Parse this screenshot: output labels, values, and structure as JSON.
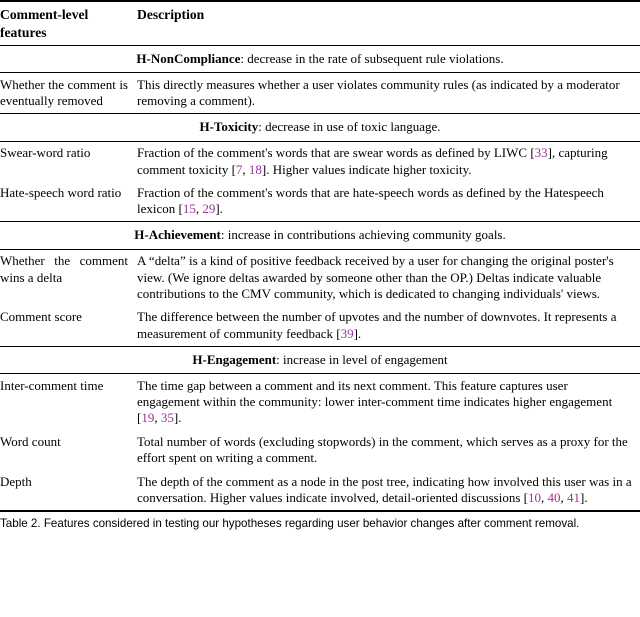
{
  "table": {
    "columns": {
      "feature_header": "Comment-level features",
      "description_header": "Description"
    },
    "sections": [
      {
        "hypothesis_name": "H-NonCompliance",
        "hypothesis_desc": ": decrease in the rate of subsequent rule violations.",
        "rows": [
          {
            "feature": "Whether the comment is eventually removed",
            "description": "This directly measures whether a user violates community rules (as indicated by a moderator removing a comment)."
          }
        ]
      },
      {
        "hypothesis_name": "H-Toxicity",
        "hypothesis_desc": ": decrease in use of toxic language.",
        "rows": [
          {
            "feature": "Swear-word ratio",
            "description_parts": [
              {
                "t": "Fraction of the comment's words that are swear words as defined by LIWC ["
              },
              {
                "t": "33",
                "cite": true
              },
              {
                "t": "], capturing comment toxicity ["
              },
              {
                "t": "7",
                "cite": true
              },
              {
                "t": ", "
              },
              {
                "t": "18",
                "cite": true
              },
              {
                "t": "]. Higher values indicate higher toxicity."
              }
            ]
          },
          {
            "feature": "Hate-speech word ratio",
            "description_parts": [
              {
                "t": "Fraction of the comment's words that are hate-speech words as defined by the Hatespeech lexicon ["
              },
              {
                "t": "15",
                "cite": true
              },
              {
                "t": ", "
              },
              {
                "t": "29",
                "cite": true
              },
              {
                "t": "]."
              }
            ]
          }
        ]
      },
      {
        "hypothesis_name": "H-Achievement",
        "hypothesis_desc": ": increase in contributions achieving community goals.",
        "rows": [
          {
            "feature": "Whether the comment wins a delta",
            "description": "A “delta” is a kind of positive feedback received by a user for changing the original poster's view. (We ignore deltas awarded by someone other than the OP.) Deltas indicate valuable contributions to the CMV community, which is dedicated to changing individuals' views."
          },
          {
            "feature": "Comment score",
            "description_parts": [
              {
                "t": "The difference between the number of upvotes and the number of downvotes. It represents a measurement of community feedback ["
              },
              {
                "t": "39",
                "cite": true
              },
              {
                "t": "]."
              }
            ]
          }
        ]
      },
      {
        "hypothesis_name": "H-Engagement",
        "hypothesis_desc": ": increase in level of engagement",
        "rows": [
          {
            "feature": "Inter-comment time",
            "description_parts": [
              {
                "t": "The time gap between a comment and its next comment. This feature captures user engagement within the community: lower inter-comment time indicates higher engagement ["
              },
              {
                "t": "19",
                "cite": true
              },
              {
                "t": ", "
              },
              {
                "t": "35",
                "cite": true
              },
              {
                "t": "]."
              }
            ]
          },
          {
            "feature": "Word count",
            "description": "Total number of words (excluding stopwords) in the comment, which serves as a proxy for the effort spent on writing a comment."
          },
          {
            "feature": "Depth",
            "description_parts": [
              {
                "t": "The depth of the comment as a node in the post tree, indicating how involved this user was in a conversation. Higher values indicate involved, detail-oriented discussions ["
              },
              {
                "t": "10",
                "cite": true
              },
              {
                "t": ", "
              },
              {
                "t": "40",
                "cite": true
              },
              {
                "t": ", "
              },
              {
                "t": "41",
                "cite": true
              },
              {
                "t": "]."
              }
            ]
          }
        ]
      }
    ]
  },
  "caption": {
    "label": "Table 2.",
    "text": "Features considered in testing our hypotheses regarding user behavior changes after comment removal."
  },
  "colors": {
    "citation": "#993399",
    "text": "#000000",
    "rule": "#000000"
  }
}
